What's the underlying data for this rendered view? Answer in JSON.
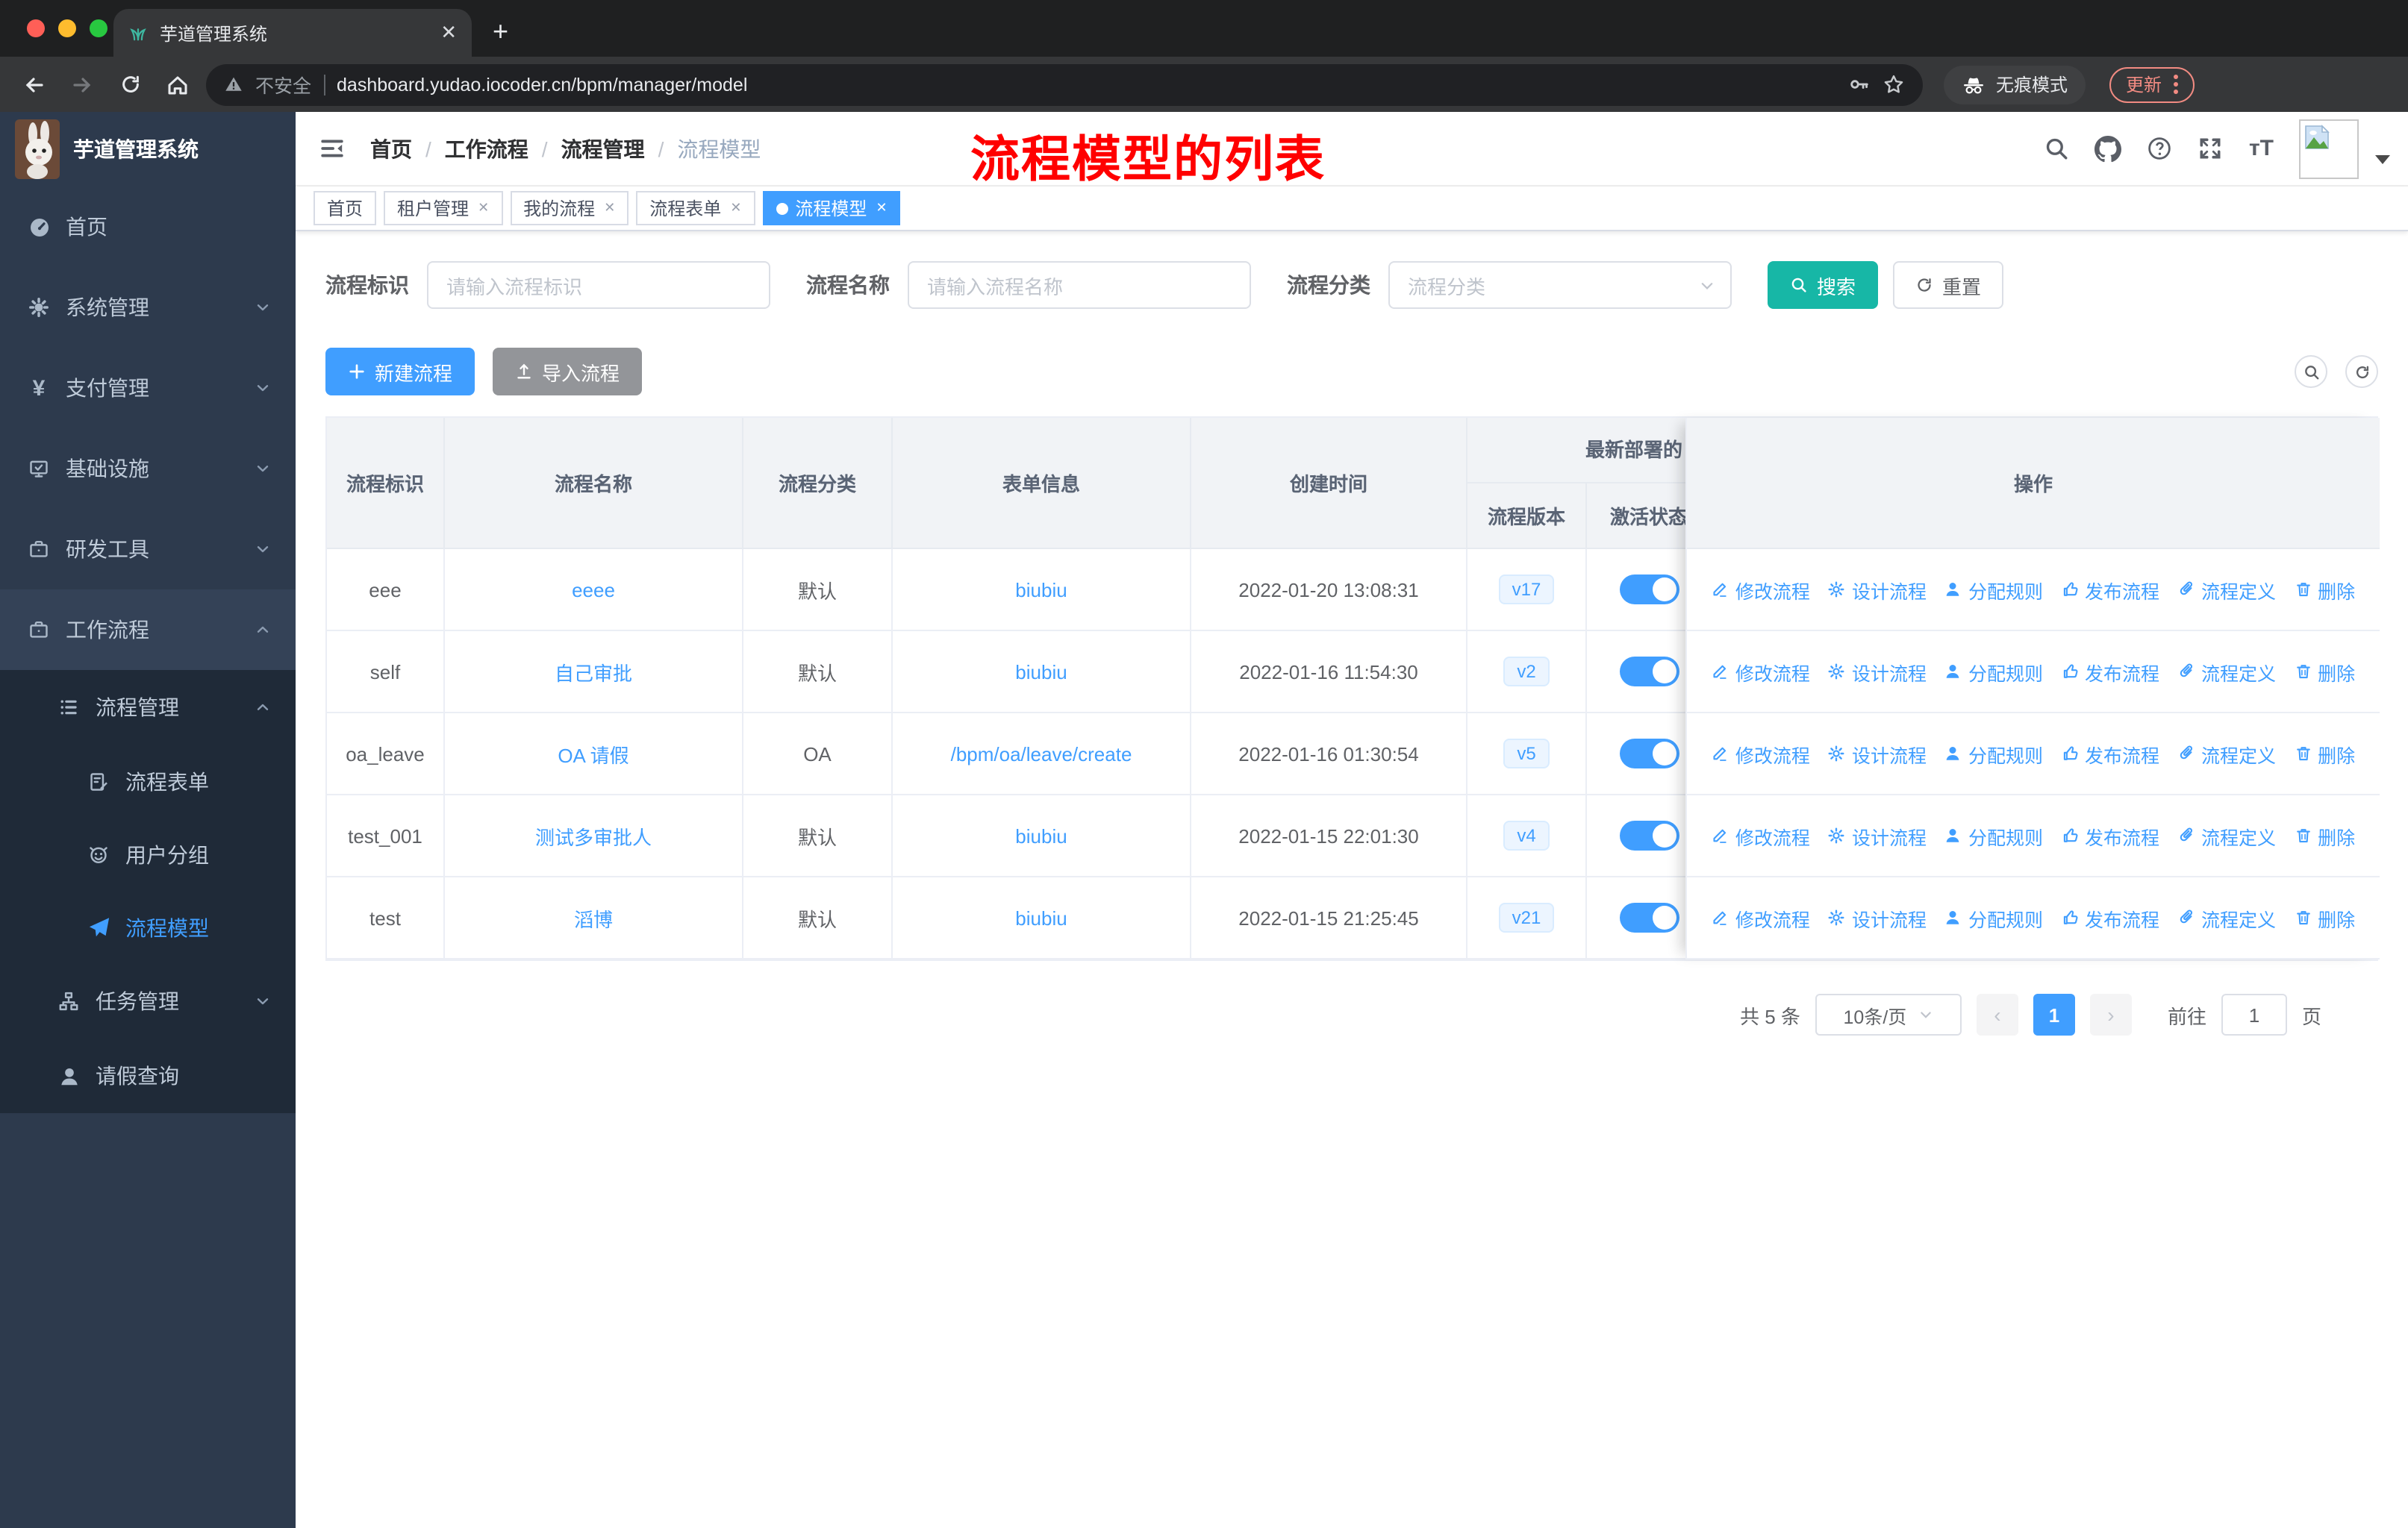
{
  "browser": {
    "tab_title": "芋道管理系统",
    "tab_close": "✕",
    "new_tab": "+",
    "security_label": "不安全",
    "url": "dashboard.yudao.iocoder.cn/bpm/manager/model",
    "incognito_label": "无痕模式",
    "update_label": "更新"
  },
  "sidebar": {
    "logo_title": "芋道管理系统",
    "items": [
      {
        "label": "首页",
        "icon": "dashboard-icon",
        "level": 1
      },
      {
        "label": "系统管理",
        "icon": "gear-icon",
        "level": 1,
        "chevron": "down"
      },
      {
        "label": "支付管理",
        "icon": "yen-icon",
        "level": 1,
        "chevron": "down"
      },
      {
        "label": "基础设施",
        "icon": "monitor-icon",
        "level": 1,
        "chevron": "down"
      },
      {
        "label": "研发工具",
        "icon": "briefcase-icon",
        "level": 1,
        "chevron": "down"
      },
      {
        "label": "工作流程",
        "icon": "briefcase-icon",
        "level": 1,
        "chevron": "up",
        "expanded": true
      },
      {
        "label": "流程管理",
        "icon": "flow-list-icon",
        "level": 2,
        "chevron": "up",
        "in_submenu": true
      },
      {
        "label": "流程表单",
        "icon": "doc-edit-icon",
        "level": 3,
        "in_submenu": true
      },
      {
        "label": "用户分组",
        "icon": "user-group-icon",
        "level": 3,
        "in_submenu": true
      },
      {
        "label": "流程模型",
        "icon": "paper-plane-icon",
        "level": 3,
        "in_submenu": true,
        "active": true
      },
      {
        "label": "任务管理",
        "icon": "org-tree-icon",
        "level": 2,
        "chevron": "down",
        "in_submenu": true
      },
      {
        "label": "请假查询",
        "icon": "person-icon",
        "level": 2,
        "in_submenu": true
      }
    ]
  },
  "navbar": {
    "breadcrumb": [
      {
        "label": "首页"
      },
      {
        "label": "工作流程"
      },
      {
        "label": "流程管理"
      },
      {
        "label": "流程模型",
        "current": true
      }
    ],
    "annotation": "流程模型的列表"
  },
  "tags": [
    {
      "label": "首页"
    },
    {
      "label": "租户管理",
      "closable": true
    },
    {
      "label": "我的流程",
      "closable": true
    },
    {
      "label": "流程表单",
      "closable": true
    },
    {
      "label": "流程模型",
      "closable": true,
      "active": true
    }
  ],
  "filters": {
    "fields": [
      {
        "label": "流程标识",
        "placeholder": "请输入流程标识",
        "type": "input"
      },
      {
        "label": "流程名称",
        "placeholder": "请输入流程名称",
        "type": "input"
      },
      {
        "label": "流程分类",
        "placeholder": "流程分类",
        "type": "select"
      }
    ],
    "search_label": "搜索",
    "reset_label": "重置"
  },
  "actions_bar": {
    "create_label": "新建流程",
    "import_label": "导入流程"
  },
  "table": {
    "columns": [
      "流程标识",
      "流程名称",
      "流程分类",
      "表单信息",
      "创建时间"
    ],
    "group_header": "最新部署的",
    "sub_columns": [
      "流程版本",
      "激活状态"
    ],
    "ops_header": "操作",
    "row_actions": [
      {
        "label": "修改流程",
        "icon": "edit-icon"
      },
      {
        "label": "设计流程",
        "icon": "design-gear-icon"
      },
      {
        "label": "分配规则",
        "icon": "assign-user-icon"
      },
      {
        "label": "发布流程",
        "icon": "publish-thumb-icon"
      },
      {
        "label": "流程定义",
        "icon": "paperclip-icon"
      },
      {
        "label": "删除",
        "icon": "trash-icon"
      }
    ],
    "rows": [
      {
        "id": "eee",
        "name": "eeee",
        "category": "默认",
        "form": "biubiu",
        "created": "2022-01-20 13:08:31",
        "version": "v17",
        "active": true
      },
      {
        "id": "self",
        "name": "自己审批",
        "category": "默认",
        "form": "biubiu",
        "created": "2022-01-16 11:54:30",
        "version": "v2",
        "active": true
      },
      {
        "id": "oa_leave",
        "name": "OA 请假",
        "category": "OA",
        "form": "/bpm/oa/leave/create",
        "created": "2022-01-16 01:30:54",
        "version": "v5",
        "active": true
      },
      {
        "id": "test_001",
        "name": "测试多审批人",
        "category": "默认",
        "form": "biubiu",
        "created": "2022-01-15 22:01:30",
        "version": "v4",
        "active": true
      },
      {
        "id": "test",
        "name": "滔博",
        "category": "默认",
        "form": "biubiu",
        "created": "2022-01-15 21:25:45",
        "version": "v21",
        "active": true
      }
    ]
  },
  "pagination": {
    "total": "共 5 条",
    "page_size": "10条/页",
    "prev": "‹",
    "page": "1",
    "next": "›",
    "goto_label": "前往",
    "goto_value": "1",
    "page_suffix": "页"
  },
  "colors": {
    "primary": "#409eff",
    "search_button": "#17b7a6",
    "sidebar": "#2d3a4d",
    "submenu": "#1f2a38",
    "annotation": "#ff0000"
  }
}
